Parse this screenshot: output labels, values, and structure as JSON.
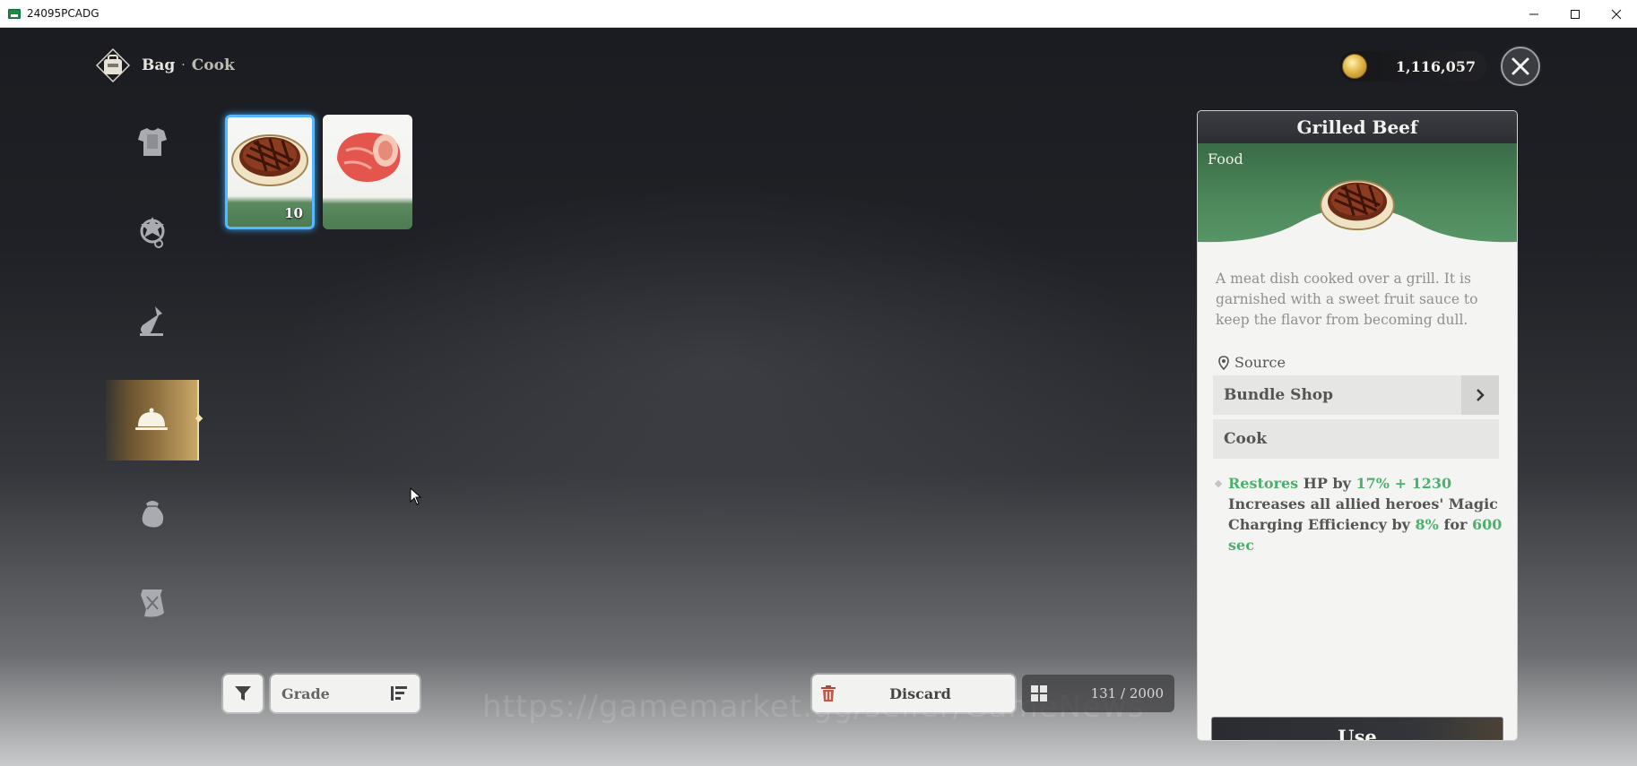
{
  "window": {
    "title": "24095PCADG"
  },
  "header": {
    "breadcrumb_main": "Bag",
    "breadcrumb_separator": "·",
    "breadcrumb_sub": "Cook",
    "currency_value": "1,116,057"
  },
  "sidebar": {
    "items": [
      {
        "icon": "armor-icon"
      },
      {
        "icon": "accessory-icon"
      },
      {
        "icon": "potion-icon"
      },
      {
        "icon": "cloche-icon",
        "active": true
      },
      {
        "icon": "material-sack-icon"
      },
      {
        "icon": "scroll-icon"
      }
    ]
  },
  "inventory": {
    "items": [
      {
        "name": "Grilled Beef",
        "quantity": "10",
        "selected": true
      },
      {
        "name": "Raw Meat",
        "quantity": ""
      }
    ]
  },
  "toolbar": {
    "sort_label": "Grade",
    "discard_label": "Discard",
    "capacity": "131 / 2000"
  },
  "watermark": "https://gamemarket.gg/seller/GameNews",
  "detail": {
    "title": "Grilled Beef",
    "category": "Food",
    "description": "A meat dish cooked over a grill. It is garnished with a sweet fruit sauce to keep the flavor from becoming dull.",
    "source_label": "Source",
    "sources": [
      "Bundle Shop",
      "Cook"
    ],
    "effect": {
      "restores": "Restores",
      "hp_by": "HP by",
      "pct": "17%",
      "plus": "+",
      "flat": "1230",
      "line2": "Increases all allied heroes' Magic Charging Efficiency by",
      "pct2": "8%",
      "for": "for",
      "duration": "600 sec"
    },
    "use_label": "Use"
  },
  "colors": {
    "accent_green": "#4fb06e",
    "selected_border": "#58b8ff",
    "active_tab_gold": "#c9a767"
  }
}
